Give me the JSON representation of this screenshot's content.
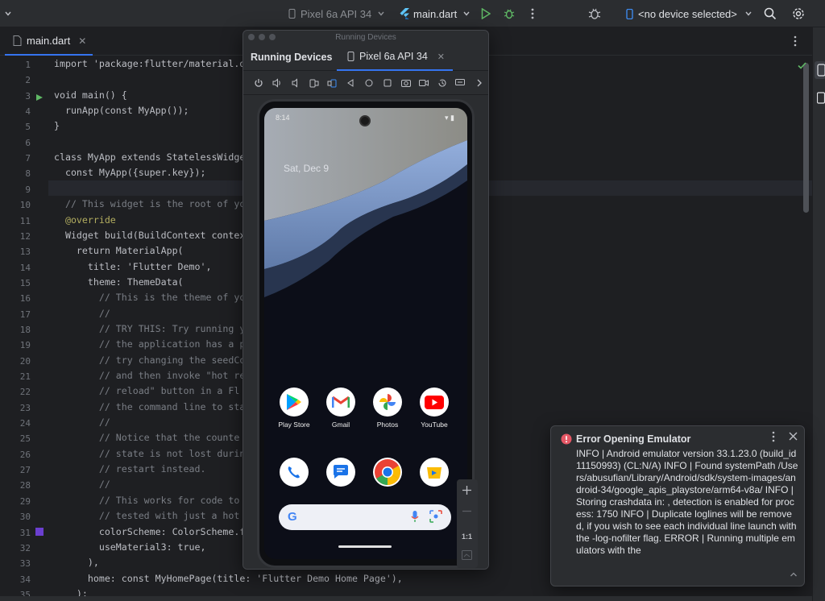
{
  "toolbar": {
    "device_config": "Pixel 6a API 34",
    "run_config": "main.dart",
    "device_selector": "<no device selected>"
  },
  "editor": {
    "tab_label": "main.dart",
    "line_numbers": [
      "1",
      "2",
      "3",
      "4",
      "5",
      "6",
      "7",
      "8",
      "9",
      "10",
      "11",
      "12",
      "13",
      "14",
      "15",
      "16",
      "17",
      "18",
      "19",
      "20",
      "21",
      "22",
      "23",
      "24",
      "25",
      "26",
      "27",
      "28",
      "29",
      "30",
      "31",
      "32",
      "33",
      "34",
      "35"
    ],
    "lines": [
      "import 'package:flutter/material.d",
      "",
      "void main() {",
      "  runApp(const MyApp());",
      "}",
      "",
      "class MyApp extends StatelessWidge",
      "  const MyApp({super.key});",
      "",
      "  // This widget is the root of yo",
      "  @override",
      "  Widget build(BuildContext contex",
      "    return MaterialApp(",
      "      title: 'Flutter Demo',",
      "      theme: ThemeData(",
      "        // This is the theme of yo",
      "        //",
      "        // TRY THIS: Try running y                                     see",
      "        // the application has a p                                     pp,",
      "        // try changing the seedCo                                     n",
      "        // and then invoke \"hot re",
      "        // reload\" button in a Fl                                      d",
      "        // the command line to sta",
      "        //",
      "        // Notice that the counte",
      "        // state is not lost durin",
      "        // restart instead.",
      "        //",
      "        // This works for code to",
      "        // tested with just a hot",
      "        colorScheme: ColorScheme.f",
      "        useMaterial3: true,",
      "      ),",
      "      home: const MyHomePage(title: 'Flutter Demo Home Page'),",
      "    );"
    ]
  },
  "running_devices": {
    "window_title": "Running Devices",
    "panel_title": "Running Devices",
    "device_tab": "Pixel 6a API 34"
  },
  "phone": {
    "time": "8:14",
    "date": "Sat, Dec 9",
    "apps_row1": [
      "Play Store",
      "Gmail",
      "Photos",
      "YouTube"
    ],
    "zoom_label": "1:1"
  },
  "notification": {
    "title": "Error Opening Emulator",
    "body": "INFO | Android emulator version 33.1.23.0 (build_id 11150993) (CL:N/A) INFO | Found systemPath /Users/abusufian/Library/Android/sdk/system-images/android-34/google_apis_playstore/arm64-v8a/ INFO | Storing crashdata in: , detection is enabled for process: 1750 INFO | Duplicate loglines will be removed, if you wish to see each individual line launch with the -log-nofilter flag. ERROR | Running multiple emulators with the"
  },
  "colors": {
    "accent": "#3574f0",
    "run_green": "#5fb865",
    "error_red": "#e55765",
    "purple_marker": "#6b3fd0"
  }
}
